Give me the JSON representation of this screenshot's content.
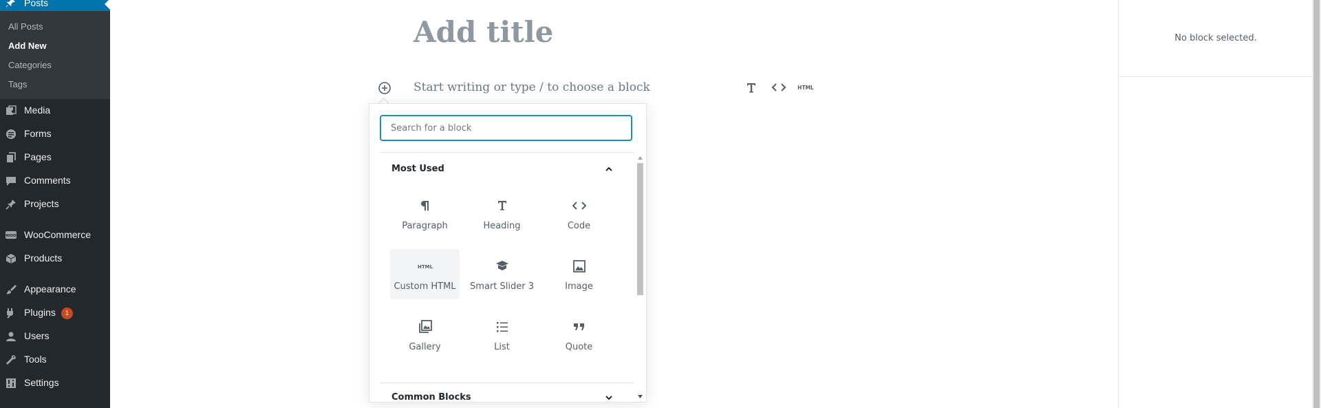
{
  "sidebar": {
    "current_section": "Posts",
    "submenu": [
      "All Posts",
      "Add New",
      "Categories",
      "Tags"
    ],
    "submenu_current": "Add New",
    "items": [
      {
        "label": "Media",
        "icon": "media-icon"
      },
      {
        "label": "Forms",
        "icon": "forms-icon"
      },
      {
        "label": "Pages",
        "icon": "pages-icon"
      },
      {
        "label": "Comments",
        "icon": "comments-icon"
      },
      {
        "label": "Projects",
        "icon": "projects-icon"
      },
      {
        "label": "WooCommerce",
        "icon": "woocommerce-icon"
      },
      {
        "label": "Products",
        "icon": "products-icon"
      },
      {
        "label": "Appearance",
        "icon": "appearance-icon"
      },
      {
        "label": "Plugins",
        "icon": "plugins-icon",
        "badge": "1"
      },
      {
        "label": "Users",
        "icon": "users-icon"
      },
      {
        "label": "Tools",
        "icon": "tools-icon"
      },
      {
        "label": "Settings",
        "icon": "settings-icon"
      }
    ]
  },
  "editor": {
    "title_placeholder": "Add title",
    "appender_placeholder": "Start writing or type / to choose a block"
  },
  "inserter": {
    "search_placeholder": "Search for a block",
    "panels": [
      {
        "title": "Most Used",
        "expanded": true,
        "blocks": [
          {
            "label": "Paragraph",
            "icon": "paragraph-icon"
          },
          {
            "label": "Heading",
            "icon": "heading-icon"
          },
          {
            "label": "Code",
            "icon": "code-icon"
          },
          {
            "label": "Custom HTML",
            "icon": "html-icon",
            "hovered": true
          },
          {
            "label": "Smart Slider 3",
            "icon": "smart-slider-icon"
          },
          {
            "label": "Image",
            "icon": "image-icon"
          },
          {
            "label": "Gallery",
            "icon": "gallery-icon"
          },
          {
            "label": "List",
            "icon": "list-icon"
          },
          {
            "label": "Quote",
            "icon": "quote-icon"
          }
        ]
      },
      {
        "title": "Common Blocks",
        "expanded": false
      }
    ]
  },
  "settings_sidebar": {
    "message": "No block selected."
  },
  "colors": {
    "admin_bg": "#23282d",
    "submenu_bg": "#32373c",
    "accent": "#0073aa",
    "focus": "#1e8cbe",
    "badge": "#ca4a1f"
  }
}
